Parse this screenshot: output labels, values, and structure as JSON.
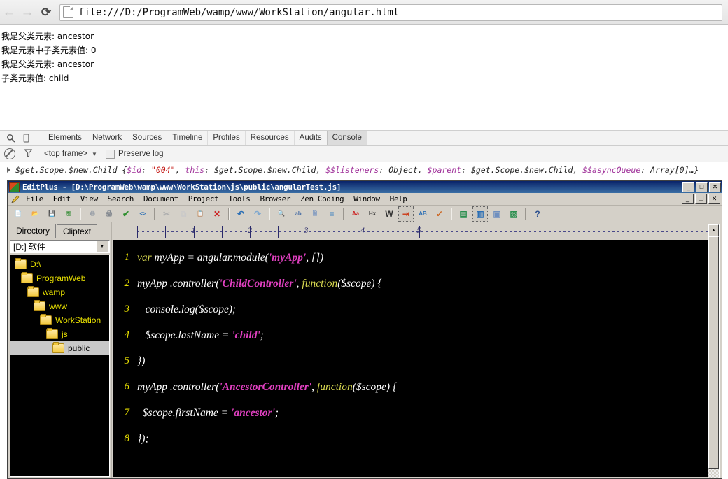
{
  "browser": {
    "back_icon": "arrow-left-icon",
    "forward_icon": "arrow-right-icon",
    "reload_icon": "reload-icon",
    "page_icon": "page-document-icon",
    "url": "file:///D:/ProgramWeb/wamp/www/WorkStation/angular.html"
  },
  "page": {
    "lines": [
      "我是父类元素: ancestor",
      "我是元素中子类元素值: 0",
      "我是父类元素: ancestor",
      "子类元素值: child"
    ]
  },
  "devtools": {
    "inspect_icon": "magnifier-inspect-icon",
    "device_icon": "device-toolbar-icon",
    "tabs": [
      {
        "label": "Elements",
        "active": false
      },
      {
        "label": "Network",
        "active": false
      },
      {
        "label": "Sources",
        "active": false
      },
      {
        "label": "Timeline",
        "active": false
      },
      {
        "label": "Profiles",
        "active": false
      },
      {
        "label": "Resources",
        "active": false
      },
      {
        "label": "Audits",
        "active": false
      },
      {
        "label": "Console",
        "active": true
      }
    ],
    "filterbar": {
      "clear_icon": "clear-console-icon",
      "filter_icon": "filter-funnel-icon",
      "frame_selector": "<top frame>",
      "frame_caret": "▼",
      "preserve_log_label": "Preserve log",
      "preserve_log_checked": false
    },
    "console": {
      "disclosure_icon": "disclosure-triangle-icon",
      "object_name": "$get.Scope.$new.Child",
      "segments": [
        {
          "text": "$get.Scope.$new.Child ",
          "kind": "name"
        },
        {
          "text": "{",
          "kind": "plain"
        },
        {
          "text": "$id",
          "kind": "key"
        },
        {
          "text": ": ",
          "kind": "plain"
        },
        {
          "text": "\"004\"",
          "kind": "str"
        },
        {
          "text": ", ",
          "kind": "plain"
        },
        {
          "text": "this",
          "kind": "key"
        },
        {
          "text": ": $get.Scope.$new.Child, ",
          "kind": "plain"
        },
        {
          "text": "$$listeners",
          "kind": "key"
        },
        {
          "text": ": Object, ",
          "kind": "plain"
        },
        {
          "text": "$parent",
          "kind": "key"
        },
        {
          "text": ": $get.Scope.$new.Child, ",
          "kind": "plain"
        },
        {
          "text": "$$asyncQueue",
          "kind": "key"
        },
        {
          "text": ": Array[0]…}",
          "kind": "plain"
        }
      ]
    }
  },
  "editplus": {
    "app_icon": "editplus-app-icon",
    "title": "EditPlus - [D:\\ProgramWeb\\wamp\\www\\WorkStation\\js\\public\\angularTest.js]",
    "window_buttons": [
      "_",
      "□",
      "✕"
    ],
    "doc_window_buttons": [
      "_",
      "❐",
      "✕"
    ],
    "menu_icon": "pencil-icon",
    "menu": [
      "File",
      "Edit",
      "View",
      "Search",
      "Document",
      "Project",
      "Tools",
      "Browser",
      "Zen Coding",
      "Window",
      "Help"
    ],
    "toolbar": [
      {
        "name": "new-file-button",
        "glyph": "📄"
      },
      {
        "name": "open-file-button",
        "glyph": "📂"
      },
      {
        "name": "save-button",
        "glyph": "💾"
      },
      {
        "name": "save-all-button",
        "glyph": "🖫"
      },
      {
        "sep": true
      },
      {
        "name": "print-preview-button",
        "glyph": "🖶"
      },
      {
        "name": "print-button",
        "glyph": "🖨"
      },
      {
        "name": "spell-check-button",
        "glyph": "✔"
      },
      {
        "name": "view-source-button",
        "glyph": "<>"
      },
      {
        "sep": true
      },
      {
        "name": "cut-button",
        "glyph": "✂"
      },
      {
        "name": "copy-button",
        "glyph": "⧉"
      },
      {
        "name": "paste-button",
        "glyph": "📋"
      },
      {
        "name": "delete-button",
        "glyph": "✕"
      },
      {
        "sep": true
      },
      {
        "name": "undo-button",
        "glyph": "↶"
      },
      {
        "name": "redo-button",
        "glyph": "↷"
      },
      {
        "sep": true
      },
      {
        "name": "find-button",
        "glyph": "🔍"
      },
      {
        "name": "replace-button",
        "glyph": "ab"
      },
      {
        "name": "find-in-files-button",
        "glyph": "🗎"
      },
      {
        "name": "goto-line-button",
        "glyph": "≡"
      },
      {
        "sep": true
      },
      {
        "name": "change-case-button",
        "glyph": "Aa"
      },
      {
        "name": "hex-view-button",
        "glyph": "Hx"
      },
      {
        "name": "word-wrap-button",
        "glyph": "W"
      },
      {
        "name": "indent-button",
        "glyph": "⇥"
      },
      {
        "name": "sort-button",
        "glyph": "AB"
      },
      {
        "name": "check-button",
        "glyph": "✓"
      },
      {
        "sep": true
      },
      {
        "name": "toggle-directory-button",
        "glyph": "▤"
      },
      {
        "name": "toggle-output-button",
        "glyph": "▥"
      },
      {
        "name": "preview-button",
        "glyph": "▣"
      },
      {
        "name": "browser-preview-button",
        "glyph": "▨"
      },
      {
        "sep": true
      },
      {
        "name": "help-pointer-button",
        "glyph": "?"
      }
    ],
    "sidebar": {
      "tabs": [
        {
          "label": "Directory",
          "active": true
        },
        {
          "label": "Cliptext",
          "active": false
        }
      ],
      "drive": "[D:] 软件",
      "drive_caret": "▼",
      "tree": [
        {
          "label": "D:\\",
          "indent": 0,
          "selected": false
        },
        {
          "label": "ProgramWeb",
          "indent": 1,
          "selected": false
        },
        {
          "label": "wamp",
          "indent": 2,
          "selected": false
        },
        {
          "label": "www",
          "indent": 3,
          "selected": false
        },
        {
          "label": "WorkStation",
          "indent": 4,
          "selected": false
        },
        {
          "label": "js",
          "indent": 5,
          "selected": false
        },
        {
          "label": "public",
          "indent": 6,
          "selected": true
        }
      ]
    },
    "ruler": {
      "numbers": [
        "1",
        "2",
        "3",
        "4",
        "5"
      ]
    },
    "editor": {
      "line_numbers": [
        "1",
        "2",
        "3",
        "4",
        "5",
        "6",
        "7",
        "8"
      ],
      "lines": [
        [
          {
            "t": "var ",
            "c": "kw"
          },
          {
            "t": "myApp = angular.module(",
            "c": "plain"
          },
          {
            "t": "'myApp'",
            "c": "str"
          },
          {
            "t": ", [])",
            "c": "plain"
          }
        ],
        [
          {
            "t": "myApp .controller(",
            "c": "plain"
          },
          {
            "t": "'ChildController'",
            "c": "str"
          },
          {
            "t": ", ",
            "c": "plain"
          },
          {
            "t": "function",
            "c": "fn"
          },
          {
            "t": "($scope) {",
            "c": "plain"
          }
        ],
        [
          {
            "t": "   console.log($scope);",
            "c": "plain"
          }
        ],
        [
          {
            "t": "   $scope.lastName = ",
            "c": "plain"
          },
          {
            "t": "'child'",
            "c": "str"
          },
          {
            "t": ";",
            "c": "plain"
          }
        ],
        [
          {
            "t": "})",
            "c": "plain"
          }
        ],
        [
          {
            "t": "myApp .controller(",
            "c": "plain"
          },
          {
            "t": "'AncestorController'",
            "c": "str"
          },
          {
            "t": ", ",
            "c": "plain"
          },
          {
            "t": "function",
            "c": "fn"
          },
          {
            "t": "($scope) {",
            "c": "plain"
          }
        ],
        [
          {
            "t": "  $scope.firstName = ",
            "c": "plain"
          },
          {
            "t": "'ancestor'",
            "c": "str"
          },
          {
            "t": ";",
            "c": "plain"
          }
        ],
        [
          {
            "t": "});",
            "c": "plain"
          }
        ]
      ]
    },
    "scrollbar": {
      "up_arrow": "▲",
      "down_arrow": "▼"
    }
  },
  "colors": {
    "titlebar_start": "#0a246a",
    "titlebar_end": "#3a6ea5",
    "window_face": "#d4d0c8",
    "editor_bg": "#000000",
    "keyword": "#d8d850",
    "string": "#e040c0",
    "linenum": "#e8e000",
    "console_key": "#a0329a",
    "console_string": "#c41a16"
  }
}
